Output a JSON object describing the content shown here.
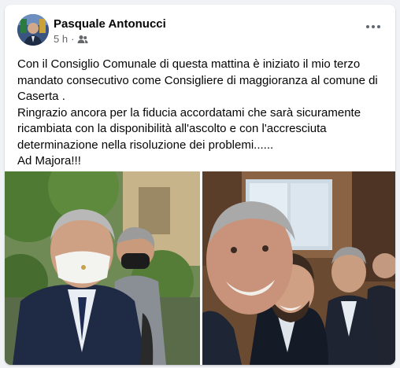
{
  "post": {
    "author": "Pasquale Antonucci",
    "time": "5 h",
    "separator": "·",
    "audience_icon": "friends-icon",
    "more_icon": "more-horizontal-icon",
    "paragraphs": [
      "Con il Consiglio Comunale di questa mattina è iniziato il mio terzo mandato consecutivo come Consigliere  di maggioranza al comune di Caserta .",
      "Ringrazio ancora per la fiducia accordatami che sarà sicuramente ricambiata con la disponibilità all'ascolto e con l'accresciuta determinazione nella risoluzione dei problemi......",
      "Ad Majora!!!"
    ]
  },
  "colors": {
    "background": "#f0f2f5",
    "card": "#ffffff",
    "text": "#050505",
    "secondary_text": "#65676b"
  }
}
